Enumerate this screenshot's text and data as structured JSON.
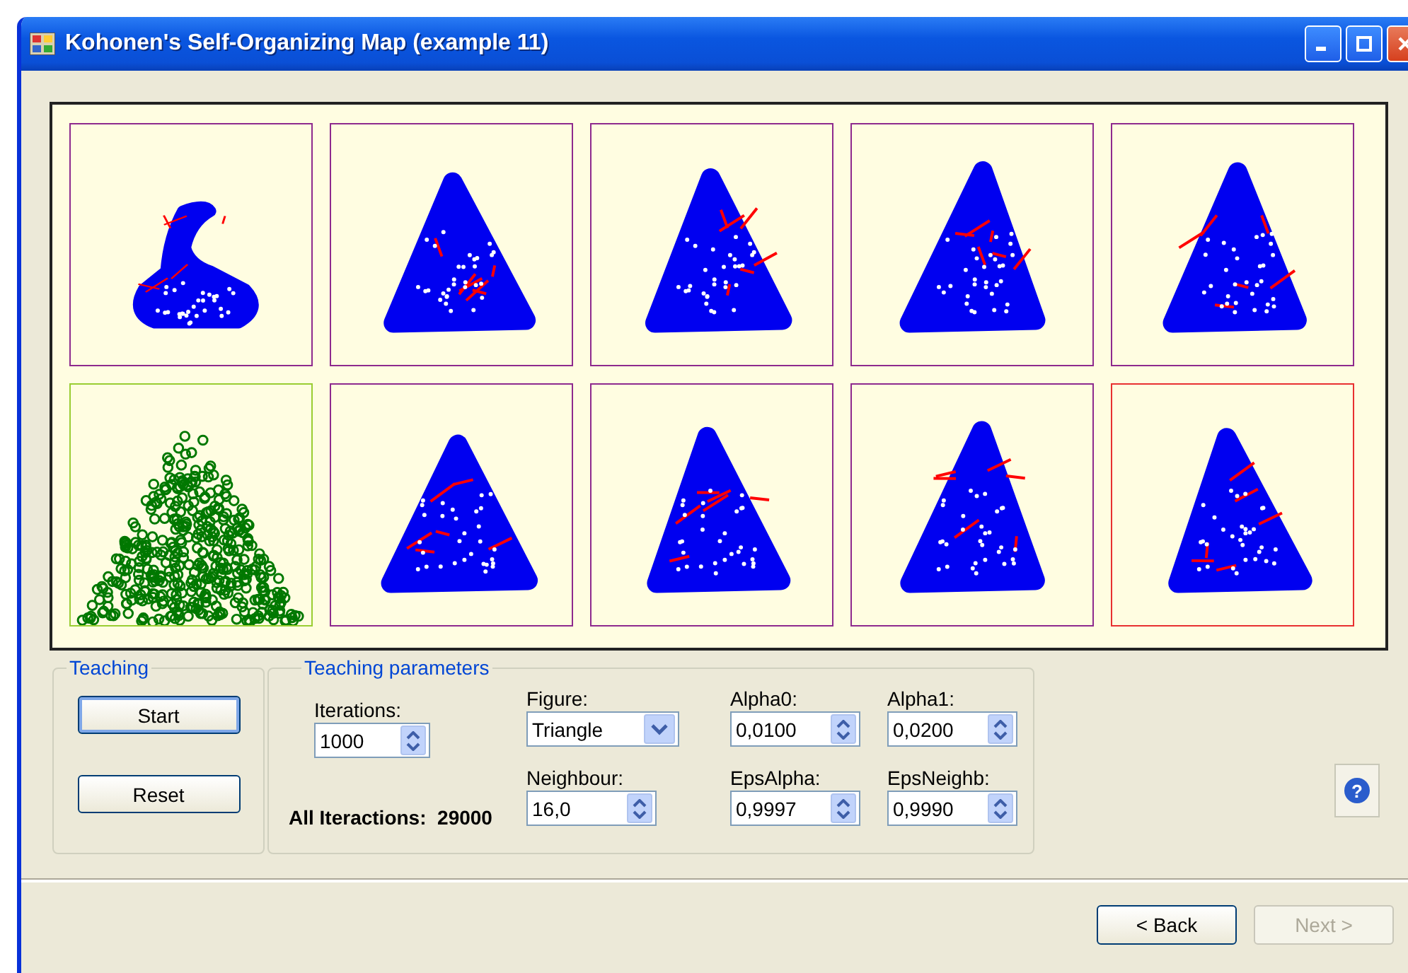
{
  "window": {
    "title": "Kohonen's Self-Organizing Map (example 11)"
  },
  "panels": [
    {
      "kind": "hook",
      "selected": false
    },
    {
      "kind": "map",
      "selected": false
    },
    {
      "kind": "map",
      "selected": false
    },
    {
      "kind": "map",
      "selected": false
    },
    {
      "kind": "map",
      "selected": false
    },
    {
      "kind": "source",
      "selected": false
    },
    {
      "kind": "map",
      "selected": false
    },
    {
      "kind": "map",
      "selected": false
    },
    {
      "kind": "map",
      "selected": false
    },
    {
      "kind": "map",
      "selected": true
    }
  ],
  "teaching": {
    "title": "Teaching",
    "buttons": [
      "Start",
      "Reset"
    ]
  },
  "parameters": {
    "title": "Teaching parameters",
    "fields": [
      {
        "label": "Iterations:",
        "value": "1000",
        "kind": "spin"
      },
      {
        "label": "Figure:",
        "value": "Triangle",
        "kind": "dropdown"
      },
      {
        "label": "Alpha0:",
        "value": "0,0100",
        "kind": "spin"
      },
      {
        "label": "Alpha1:",
        "value": "0,0200",
        "kind": "spin"
      },
      {
        "label": "Neighbour:",
        "value": "16,0",
        "kind": "spin"
      },
      {
        "label": "EpsAlpha:",
        "value": "0,9997",
        "kind": "spin"
      },
      {
        "label": "EpsNeighb:",
        "value": "0,9990",
        "kind": "spin"
      }
    ],
    "total": {
      "label": "All Iteractions:",
      "value": "29000"
    }
  },
  "help": "?",
  "nav": [
    {
      "label": "< Back",
      "disabled": false
    },
    {
      "label": "Next >",
      "disabled": true
    }
  ]
}
